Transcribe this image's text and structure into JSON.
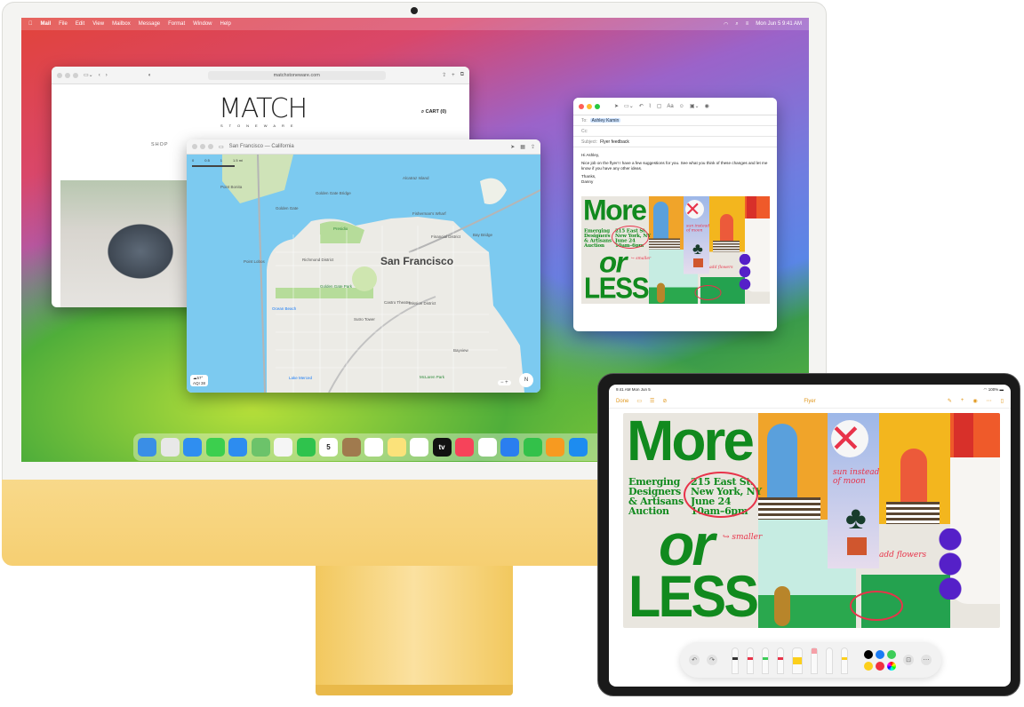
{
  "menubar": {
    "items": [
      "Mail",
      "File",
      "Edit",
      "View",
      "Mailbox",
      "Message",
      "Format",
      "Window",
      "Help"
    ],
    "clock": "Mon Jun 5  9:41 AM"
  },
  "safari": {
    "url": "matchstoneware.com",
    "logo": "MATCH",
    "logo_sub": "STONEWARE",
    "cart": "CART (0)",
    "nav": "SHOP"
  },
  "maps": {
    "title": "San Francisco — California",
    "city": "San Francisco",
    "scale": [
      "0",
      "0.5",
      "1",
      "1.5 mi"
    ],
    "labels": [
      "Point Bonita",
      "Golden Gate",
      "Presidio",
      "Richmond District",
      "Point Lobos",
      "Golden Gate Park",
      "Ocean Beach",
      "Mission District",
      "Financial District",
      "Bayview",
      "McLaren Park",
      "Lake Merced",
      "Alcatraz Island",
      "Golden Gate Bridge",
      "Fisherman's Wharf",
      "Bay Bridge",
      "Sutro Tower",
      "Castro Theatre"
    ],
    "weather_temp": "57°",
    "aqi": "AQI 38",
    "compass": "N"
  },
  "mail": {
    "to_label": "To:",
    "to": "Ashley Kamin",
    "cc_label": "Cc:",
    "subject_label": "Subject:",
    "subject": "Flyer feedback",
    "greeting": "Hi Ashley,",
    "body": "Nice job on the flyer! I have a few suggestions for you. See what you think of these changes and let me know if you have any other ideas.",
    "signoff": "Thanks,",
    "signature": "Danny"
  },
  "dock": [
    {
      "name": "finder",
      "color": "#3a8ee6"
    },
    {
      "name": "launchpad",
      "color": "#e8e8e8"
    },
    {
      "name": "safari",
      "color": "#2f8ef0"
    },
    {
      "name": "messages",
      "color": "#3ccf4e"
    },
    {
      "name": "mail",
      "color": "#2d8cf0"
    },
    {
      "name": "maps",
      "color": "#6cc36a"
    },
    {
      "name": "photos",
      "color": "#f5f5f5"
    },
    {
      "name": "facetime",
      "color": "#2fc34d"
    },
    {
      "name": "calendar",
      "color": "#ffffff",
      "text": "5"
    },
    {
      "name": "contacts",
      "color": "#a07a4e"
    },
    {
      "name": "reminders",
      "color": "#ffffff"
    },
    {
      "name": "notes",
      "color": "#fbe27a"
    },
    {
      "name": "freeform",
      "color": "#ffffff"
    },
    {
      "name": "tv",
      "color": "#111111",
      "text": "tv"
    },
    {
      "name": "music",
      "color": "#f6435a"
    },
    {
      "name": "news",
      "color": "#ffffff"
    },
    {
      "name": "keynote",
      "color": "#2a7ef0"
    },
    {
      "name": "numbers",
      "color": "#33c14a"
    },
    {
      "name": "pages",
      "color": "#f79a20"
    },
    {
      "name": "app-store",
      "color": "#1d8cf0"
    }
  ],
  "ipad": {
    "time": "9:41 AM  Mon Jun 5",
    "battery": "100%",
    "done": "Done",
    "title": "Flyer",
    "colors": [
      "#000000",
      "#1a7cf5",
      "#3ccd58",
      "#fccf1b",
      "#f0303f",
      "rainbow"
    ]
  },
  "flyer": {
    "more": "More",
    "details_left": [
      "Emerging",
      "Designers",
      "& Artisans",
      "Auction"
    ],
    "details_right": [
      "215 East St.",
      "New York, NY",
      "June 24",
      "10am–6pm"
    ],
    "or": "or",
    "less": "LESS",
    "annotations": {
      "sun": "sun instead of moon",
      "smaller": "smaller",
      "flowers": "add flowers"
    }
  },
  "colors": {
    "flyer_green": "#118a1e",
    "annotation_red": "#e8334a",
    "accent_orange": "#e0961a"
  }
}
